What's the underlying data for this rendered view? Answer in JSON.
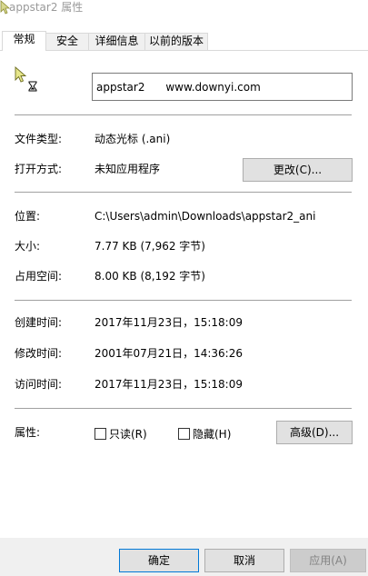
{
  "window": {
    "title": "appstar2 属性"
  },
  "tabs": [
    {
      "label": "常规"
    },
    {
      "label": "安全"
    },
    {
      "label": "详细信息"
    },
    {
      "label": "以前的版本"
    }
  ],
  "general": {
    "filename": "appstar2      www.downyi.com",
    "file_type_label": "文件类型:",
    "file_type_value": "动态光标 (.ani)",
    "open_with_label": "打开方式:",
    "open_with_value": "未知应用程序",
    "change_button": "更改(C)...",
    "location_label": "位置:",
    "location_value": "C:\\Users\\admin\\Downloads\\appstar2_ani",
    "size_label": "大小:",
    "size_value": "7.77 KB (7,962 字节)",
    "size_on_disk_label": "占用空间:",
    "size_on_disk_value": "8.00 KB (8,192 字节)",
    "created_label": "创建时间:",
    "created_value": "2017年11月23日，15:18:09",
    "modified_label": "修改时间:",
    "modified_value": "2001年07月21日，14:36:26",
    "accessed_label": "访问时间:",
    "accessed_value": "2017年11月23日，15:18:09",
    "attributes_label": "属性:",
    "readonly_label": "只读(R)",
    "readonly_checked": false,
    "hidden_label": "隐藏(H)",
    "hidden_checked": false,
    "advanced_button": "高级(D)..."
  },
  "footer": {
    "ok_button": "确定",
    "cancel_button": "取消",
    "apply_button": "应用(A)"
  },
  "colors": {
    "title_text": "#9a9a9a",
    "separator": "#a0a0a0",
    "button_bg": "#e1e1e1",
    "footer_bg": "#f0f0f0",
    "default_button_border": "#0078d7"
  }
}
